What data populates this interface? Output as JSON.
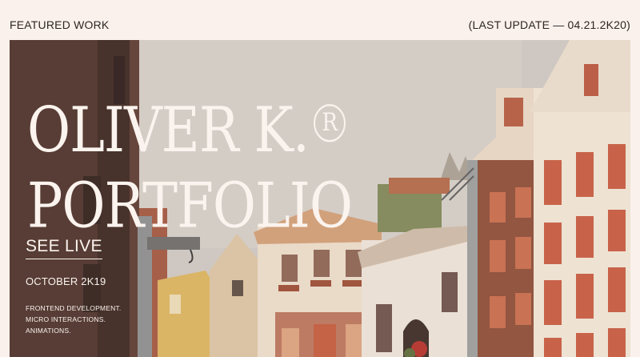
{
  "header": {
    "left_label": "FEATURED WORK",
    "right_label": "(LAST UPDATE — 04.21.2K20)"
  },
  "hero": {
    "title_line1": "OLIVER K.",
    "registered_mark": "R",
    "title_line2": "PORTFOLIO",
    "cta_label": "SEE LIVE",
    "date": "OCTOBER 2K19",
    "tags": [
      "FRONTEND DEVELOPMENT.",
      "MICRO INTERACTIONS.",
      "ANIMATIONS."
    ],
    "image_icon": "amsterdam-canal-houses-photo"
  },
  "colors": {
    "page_bg": "#fbf1ec",
    "hero_text": "#fbf3ee",
    "header_text": "#2c2523"
  }
}
